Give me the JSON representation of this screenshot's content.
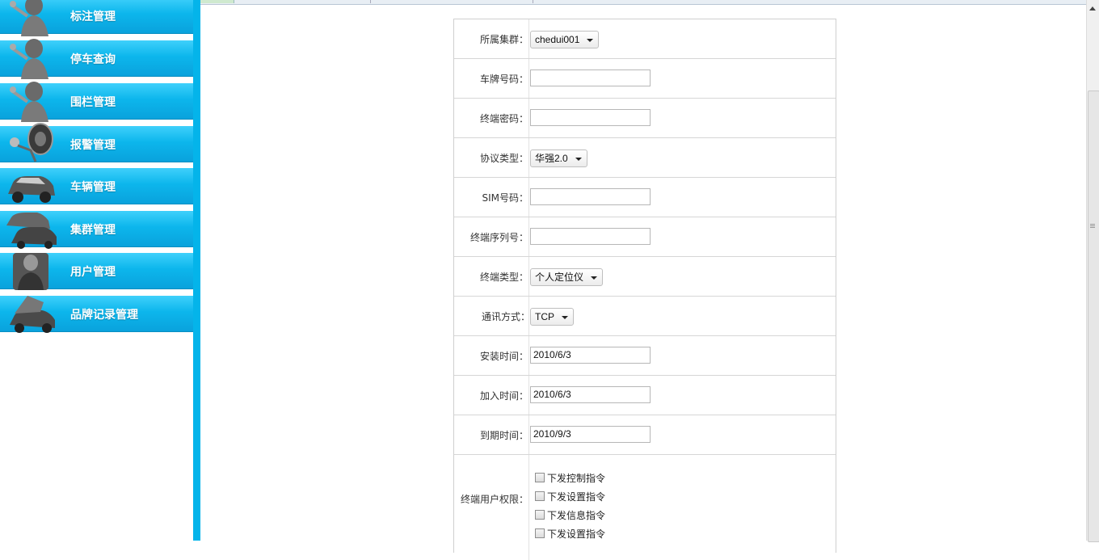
{
  "nav": {
    "items": [
      {
        "label": "标注管理",
        "icon": "mechanic-icon"
      },
      {
        "label": "停车查询",
        "icon": "mechanic-icon"
      },
      {
        "label": "围栏管理",
        "icon": "mechanic-icon"
      },
      {
        "label": "报警管理",
        "icon": "car-key-remote-icon"
      },
      {
        "label": "车辆管理",
        "icon": "car-icon"
      },
      {
        "label": "集群管理",
        "icon": "cars-group-icon"
      },
      {
        "label": "用户管理",
        "icon": "user-mechanic-icon"
      },
      {
        "label": "品牌记录管理",
        "icon": "car-open-hood-icon"
      }
    ]
  },
  "form": {
    "cluster": {
      "label": "所属集群：",
      "value": "chedui001"
    },
    "plate": {
      "label": "车牌号码：",
      "value": ""
    },
    "terminal_password": {
      "label": "终端密码：",
      "value": ""
    },
    "protocol": {
      "label": "协议类型：",
      "value": "华强2.0"
    },
    "sim": {
      "label": "SIM号码：",
      "value": ""
    },
    "serial": {
      "label": "终端序列号：",
      "value": ""
    },
    "terminal_type": {
      "label": "终端类型：",
      "value": "个人定位仪"
    },
    "comm_mode": {
      "label": "通讯方式：",
      "value": "TCP"
    },
    "install_time": {
      "label": "安装时间：",
      "value": "2010/6/3"
    },
    "join_time": {
      "label": "加入时间：",
      "value": "2010/6/3"
    },
    "expire_time": {
      "label": "到期时间：",
      "value": "2010/9/3"
    },
    "permissions": {
      "label": "终端用户权限：",
      "options": [
        "下发控制指令",
        "下发设置指令",
        "下发信息指令",
        "下发设置指令"
      ]
    }
  },
  "colors": {
    "nav_blue": "#0cb6ec",
    "rail_blue": "#04b4ea"
  }
}
